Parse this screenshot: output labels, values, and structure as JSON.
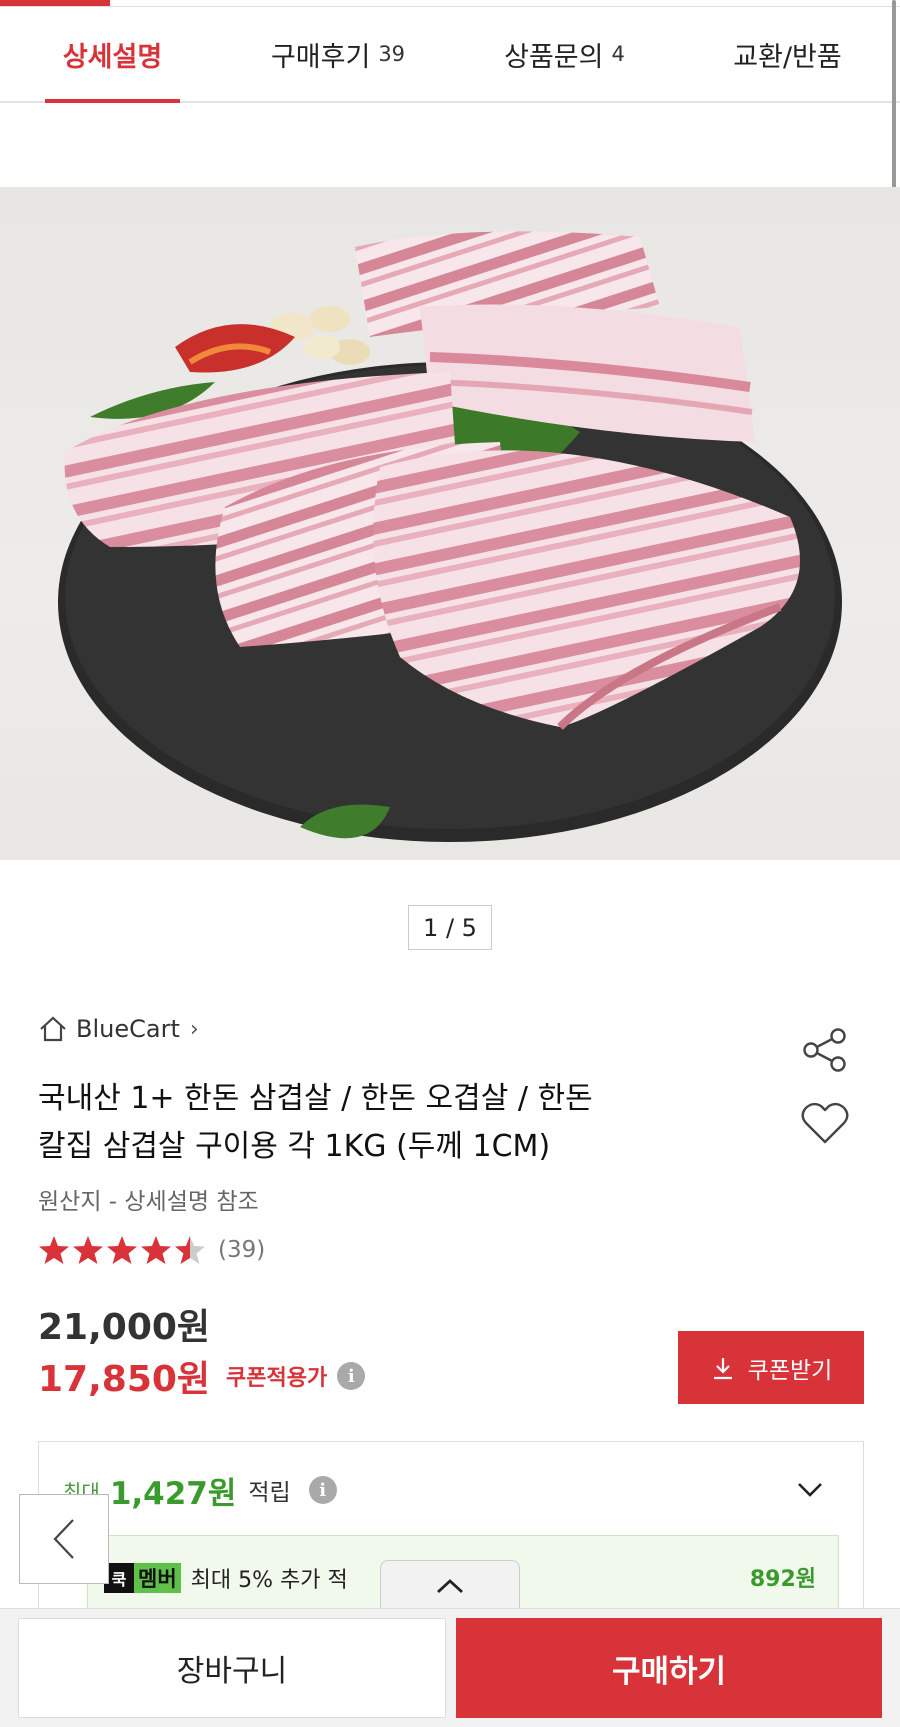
{
  "tabs": [
    {
      "label": "상세설명",
      "count": ""
    },
    {
      "label": "구매후기",
      "count": "39"
    },
    {
      "label": "상품문의",
      "count": "4"
    },
    {
      "label": "교환/반품",
      "count": ""
    }
  ],
  "gallery": {
    "pager": "1 / 5"
  },
  "product": {
    "store": "BlueCart",
    "store_chevron": "›",
    "title_line1": "국내산 1+ 한돈 삼겹살 / 한돈 오겹살 / 한돈",
    "title_line2": "칼집 삼겹살 구이용 각 1KG (두께 1CM)",
    "origin": "원산지 - 상세설명 참조",
    "rating": 4.5,
    "review_count": "(39)",
    "original_price": "21,000원",
    "sale_price": "17,850원",
    "coupon_note": "쿠폰적용가",
    "info_glyph": "i"
  },
  "coupon_button": {
    "label": "쿠폰받기"
  },
  "reward": {
    "prefix": "최대",
    "amount": "1,427원",
    "suffix": "적립"
  },
  "member": {
    "badge_dark": "쿡",
    "badge": "멤버",
    "text": "최대 5% 추가 적",
    "amount": "892원"
  },
  "bottom": {
    "cart_label": "장바구니",
    "buy_label": "구매하기"
  },
  "colors": {
    "accent": "#d9333a",
    "green": "#3b9a2e"
  },
  "icons": [
    "home-icon",
    "chevron-right-icon",
    "share-icon",
    "heart-icon",
    "star-icon",
    "info-icon",
    "download-icon",
    "chevron-down-icon",
    "chevron-left-icon",
    "chevron-up-icon"
  ]
}
